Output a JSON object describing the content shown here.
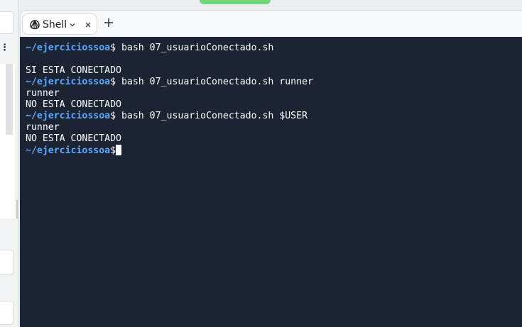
{
  "tabs": [
    {
      "label": "Shell",
      "icon": "shell-icon",
      "active": true
    }
  ],
  "terminal": {
    "lines": [
      {
        "kind": "prompt",
        "path": "~/ejerciciossoa",
        "symbol": "$",
        "command": " bash 07_usuarioConectado.sh"
      },
      {
        "kind": "output",
        "text": ""
      },
      {
        "kind": "output",
        "text": "SI ESTA CONECTADO"
      },
      {
        "kind": "prompt",
        "path": "~/ejerciciossoa",
        "symbol": "$",
        "command": " bash 07_usuarioConectado.sh runner"
      },
      {
        "kind": "output",
        "text": "runner"
      },
      {
        "kind": "output",
        "text": "NO ESTA CONECTADO"
      },
      {
        "kind": "prompt",
        "path": "~/ejerciciossoa",
        "symbol": "$",
        "command": " bash 07_usuarioConectado.sh $USER"
      },
      {
        "kind": "output",
        "text": "runner"
      },
      {
        "kind": "output",
        "text": "NO ESTA CONECTADO"
      },
      {
        "kind": "prompt",
        "path": "~/ejerciciossoa",
        "symbol": "$",
        "command": ""
      }
    ]
  },
  "colors": {
    "terminal_bg": "#1c2333",
    "prompt_path": "#5aa9ff",
    "text": "#ffffff",
    "accent_green": "#6fd97a"
  },
  "icons": {
    "tab_icon": "shell-icon",
    "tab_dropdown": "chevron-down-icon",
    "tab_close": "close-icon",
    "new_tab": "plus-icon",
    "sidebar_menu": "more-vertical-icon"
  }
}
